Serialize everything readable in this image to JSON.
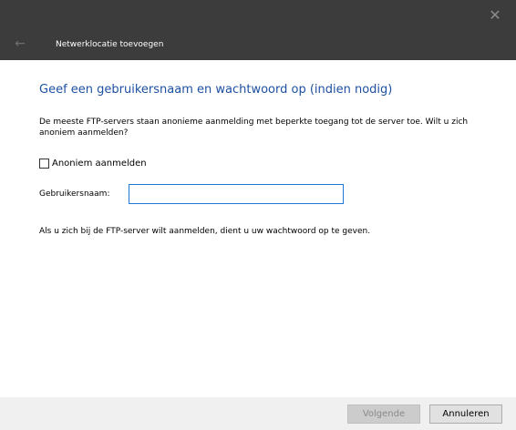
{
  "window": {
    "title": "Netwerklocatie toevoegen",
    "close_glyph": "✕",
    "back_glyph": "←"
  },
  "main": {
    "heading": "Geef een gebruikersnaam en wachtwoord op (indien nodig)",
    "description": "De meeste FTP-servers staan anonieme aanmelding met beperkte toegang tot de server toe. Wilt u zich anoniem aanmelden?",
    "anonymous_checkbox": {
      "label": "Anoniem aanmelden",
      "checked": false
    },
    "username": {
      "label": "Gebruikersnaam:",
      "value": ""
    },
    "info": "Als u zich bij de FTP-server wilt aanmelden, dient u uw wachtwoord op te geven."
  },
  "footer": {
    "next_label": "Volgende",
    "cancel_label": "Annuleren"
  },
  "colors": {
    "titlebar": "#3c3c3c",
    "heading": "#1e50a0",
    "input_border": "#1e7ad8",
    "footer": "#f0f0f0"
  }
}
